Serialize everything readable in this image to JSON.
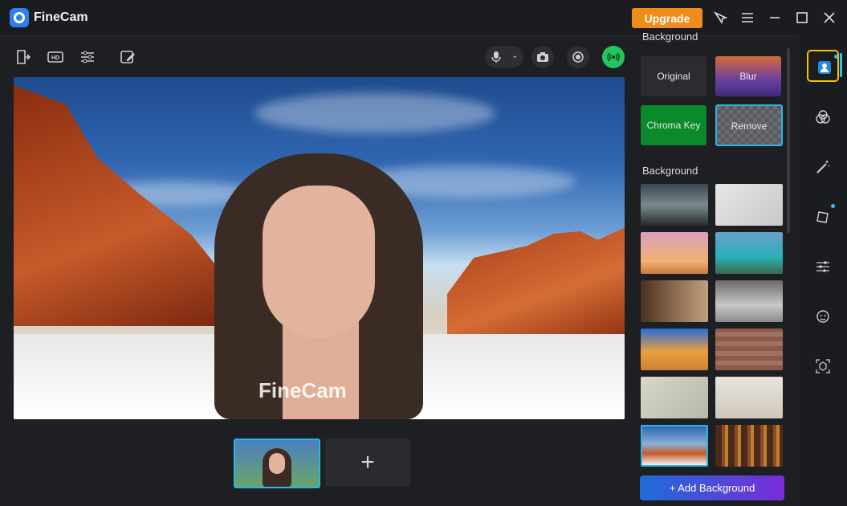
{
  "app": {
    "title": "FineCam",
    "upgrade_label": "Upgrade"
  },
  "preview": {
    "watermark": "FineCam"
  },
  "thumbnails": {
    "add_label": "+"
  },
  "panel": {
    "section1_title": "Background",
    "options": [
      {
        "label": "Original",
        "bg": "#2b2c30"
      },
      {
        "label": "Blur",
        "bg": "#5a4a8a"
      },
      {
        "label": "Chroma Key",
        "bg": "#0a8a2a"
      },
      {
        "label": "Remove",
        "bg": "#5f5f66"
      }
    ],
    "section2_title": "Background",
    "add_background_label": "+ Add Background"
  },
  "colors": {
    "accent": "#2ab7e8",
    "upgrade": "#f08c1a",
    "highlight": "#f5c400",
    "live": "#22c55e"
  }
}
